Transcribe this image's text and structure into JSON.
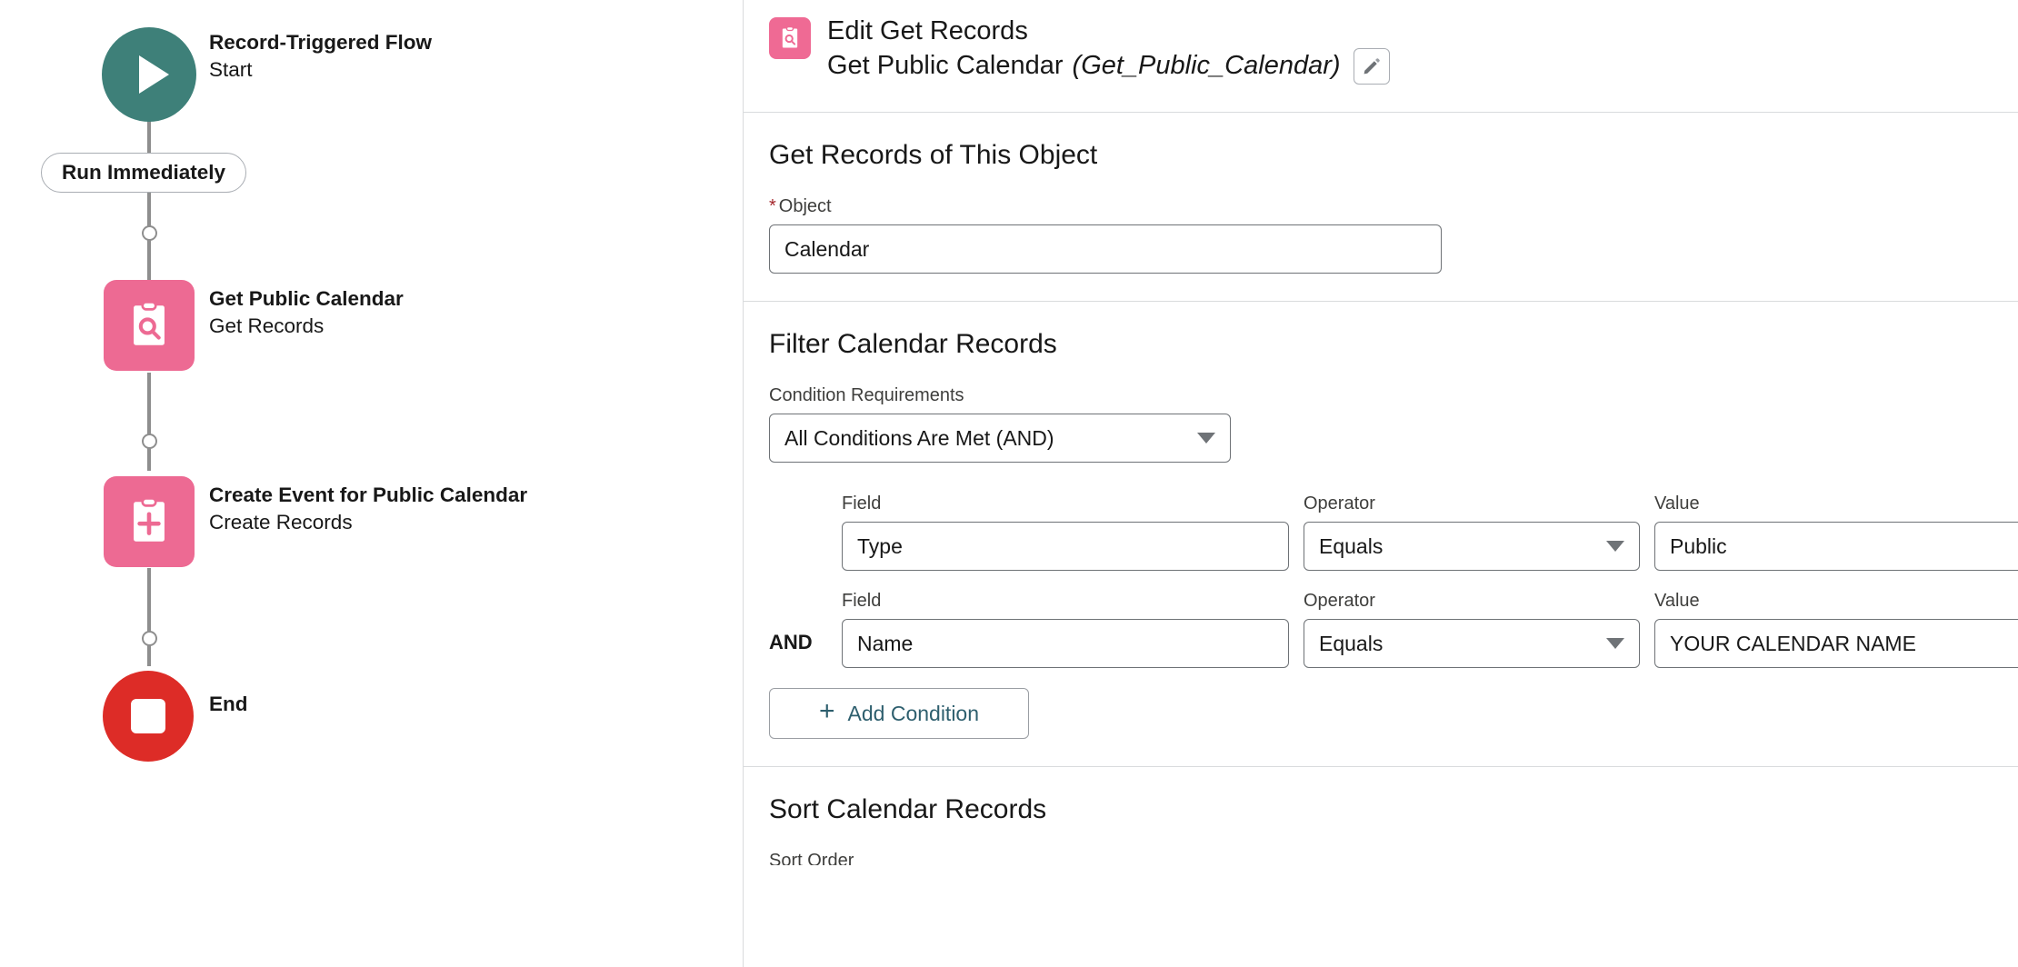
{
  "colors": {
    "start_teal": "#3e8079",
    "element_pink": "#ed6a93",
    "end_red": "#dd2c27",
    "link_teal": "#2e5f6e",
    "required_red": "#a4262c"
  },
  "flow_canvas": {
    "start_node": {
      "icon": "play-icon",
      "title": "Record-Triggered Flow",
      "subtitle": "Start"
    },
    "schedule_pill": {
      "label": "Run Immediately"
    },
    "nodes": [
      {
        "icon": "clipboard-search-icon",
        "title": "Get Public Calendar",
        "subtitle": "Get Records"
      },
      {
        "icon": "clipboard-plus-icon",
        "title": "Create Event for Public Calendar",
        "subtitle": "Create Records"
      }
    ],
    "end_node": {
      "icon": "stop-icon",
      "label": "End"
    }
  },
  "panel": {
    "header": {
      "icon": "clipboard-search-icon",
      "line1": "Edit Get Records",
      "element_label": "Get Public Calendar",
      "api_name": "(Get_Public_Calendar)",
      "edit_button_icon": "pencil-icon"
    },
    "object_section": {
      "title": "Get Records of This Object",
      "object_label": "Object",
      "object_required": "*",
      "object_value": "Calendar"
    },
    "filter_section": {
      "title": "Filter Calendar Records",
      "condition_req_label": "Condition Requirements",
      "condition_req_value": "All Conditions Are Met (AND)",
      "col_headers": {
        "field": "Field",
        "operator": "Operator",
        "value": "Value"
      },
      "conditions": [
        {
          "logic": "",
          "field": "Type",
          "operator": "Equals",
          "value": "Public"
        },
        {
          "logic": "AND",
          "field": "Name",
          "operator": "Equals",
          "value": "YOUR CALENDAR NAME"
        }
      ],
      "add_condition_label": "Add Condition",
      "add_condition_icon": "plus-icon"
    },
    "sort_section": {
      "title": "Sort Calendar Records",
      "sort_order_label": "Sort Order"
    }
  }
}
